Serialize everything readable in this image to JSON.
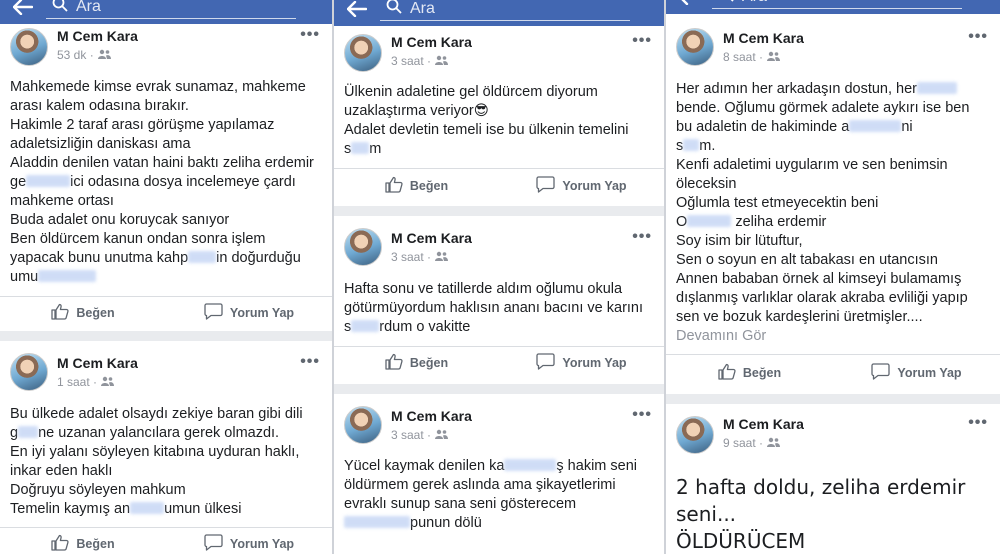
{
  "search": {
    "placeholder": "Ara"
  },
  "author": "M Cem Kara",
  "actions": {
    "like": "Beğen",
    "comment": "Yorum Yap"
  },
  "more": "•••",
  "column1": {
    "post1": {
      "time": "53 dk ·",
      "lines": [
        "Mahkemede kimse evrak sunamaz, mahkeme",
        "arası kalem odasına bırakır.",
        "Hakimle 2 taraf arası görüşme yapılamaz",
        "adaletsizliğin daniskası ama",
        "Aladdin denilen vatan haini baktı zeliha erdemir",
        "ge",
        "ici odasına dosya incelemeye çardı",
        "mahkeme ortası",
        "Buda adalet onu koruycak sanıyor",
        "Ben öldürcem kanun ondan sonra işlem",
        "yapacak bunu unutma kahp",
        "in doğurduğu",
        "umu"
      ]
    },
    "post2": {
      "time": "1 saat ·",
      "lines": [
        "Bu ülkede adalet olsaydı zekiye baran gibi dili",
        "g",
        "ne uzanan yalancılara gerek olmazdı.",
        "En iyi yalanı söyleyen kitabına uyduran haklı,",
        "inkar eden haklı",
        "Doğruyu söyleyen mahkum",
        "Temelin kaymış an",
        "umun ülkesi"
      ]
    }
  },
  "column2": {
    "post1": {
      "time": "3 saat ·",
      "lines": [
        "Ülkenin adaletine gel öldürcem diyorum",
        "uzaklaştırma veriyor😎",
        "Adalet devletin temeli ise bu ülkenin temelini",
        "s",
        "m"
      ]
    },
    "post2": {
      "time": "3 saat ·",
      "lines": [
        "Hafta sonu ve tatillerde aldım oğlumu okula",
        "götürmüyordum haklısın ananı bacını ve karını",
        "s",
        "rdum o vakitte"
      ]
    },
    "post3": {
      "time": "3 saat ·",
      "lines": [
        "Yücel kaymak denilen ka",
        "ş hakim seni",
        "öldürmem gerek aslında ama şikayetlerimi",
        "evraklı sunup sana seni gösterecem",
        "punun dölü"
      ]
    }
  },
  "column3": {
    "post1": {
      "time": "8 saat ·",
      "lines": [
        "Her adımın her arkadaşın dostun, her",
        "bende. Oğlumu görmek adalete aykırı ise ben",
        "bu adaletin de hakiminde a",
        "ni",
        "s",
        "m.",
        "Kenfi adaletimi uygularım ve sen benimsin",
        "öleceksin",
        "Oğlumla test etmeyecektin beni",
        "O",
        "zeliha erdemir",
        "Soy isim bir lütuftur,",
        "Sen o soyun en alt tabakası en utancısın",
        "Annen bababan örnek al kimseyi bulamamış",
        "dışlanmış varlıklar olarak akraba evliliği yapıp",
        "sen ve bozuk kardeşlerini üretmişler...."
      ],
      "see_more": "Devamını Gör"
    },
    "post2": {
      "time": "9 saat ·",
      "lines": [
        "2 hafta doldu, zeliha erdemir",
        "seni...",
        "ÖLDÜRÜCEM"
      ]
    }
  }
}
